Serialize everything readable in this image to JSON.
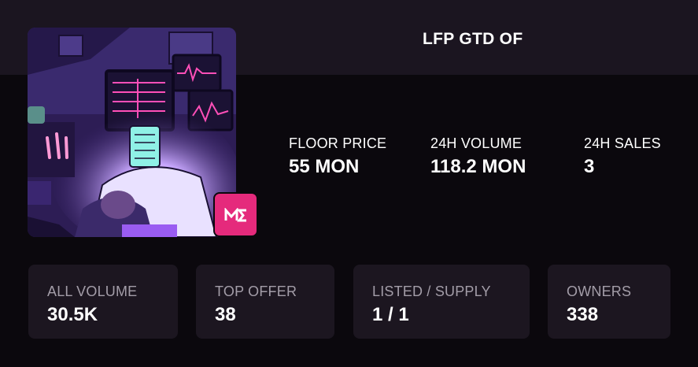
{
  "collection": {
    "title": "LFP GTD OF",
    "badge_icon": "magic-eden-logo-icon",
    "badge_color": "#e52a7c"
  },
  "stats": [
    {
      "label": "FLOOR PRICE",
      "value": "55 MON"
    },
    {
      "label": "24H VOLUME",
      "value": "118.2 MON"
    },
    {
      "label": "24H SALES",
      "value": "3"
    }
  ],
  "cards": [
    {
      "label": "ALL VOLUME",
      "value": "30.5K"
    },
    {
      "label": "TOP OFFER",
      "value": "38"
    },
    {
      "label": "LISTED / SUPPLY",
      "value": "1 / 1"
    },
    {
      "label": "OWNERS",
      "value": "338"
    }
  ],
  "colors": {
    "background": "#0b080d",
    "header_band": "#1b1520",
    "card_background": "#1c1620",
    "card_label": "#a39da8"
  }
}
